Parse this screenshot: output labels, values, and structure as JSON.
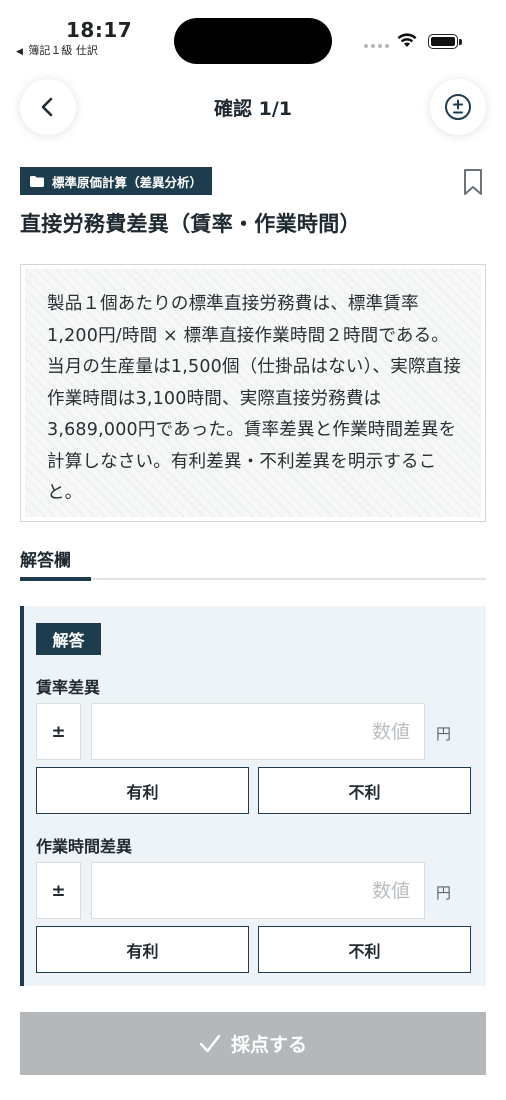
{
  "status_bar": {
    "time": "18:17",
    "back_app": "簿記１級 仕訳"
  },
  "nav": {
    "title": "確認 1/1"
  },
  "category": {
    "label": "標準原価計算（差異分析）"
  },
  "question": {
    "title": "直接労務費差異（賃率・作業時間）",
    "body": "製品１個あたりの標準直接労務費は、標準賃率1,200円/時間 × 標準直接作業時間２時間である。当月の生産量は1,500個（仕掛品はない）、実際直接作業時間は3,100時間、実際直接労務費は3,689,000円であった。賃率差異と作業時間差異を計算しなさい。有利差異・不利差異を明示すること。"
  },
  "answer_section": {
    "tab_label": "解答欄",
    "badge": "解答",
    "fields": [
      {
        "label": "賃率差異",
        "sign": "±",
        "placeholder": "数値",
        "unit": "円",
        "favorable": "有利",
        "unfavorable": "不利"
      },
      {
        "label": "作業時間差異",
        "sign": "±",
        "placeholder": "数値",
        "unit": "円",
        "favorable": "有利",
        "unfavorable": "不利"
      }
    ]
  },
  "submit": {
    "label": "採点する"
  },
  "colors": {
    "primary": "#1d3d4e",
    "panel": "#edf3f6",
    "submit_disabled": "#b4b8bb"
  }
}
